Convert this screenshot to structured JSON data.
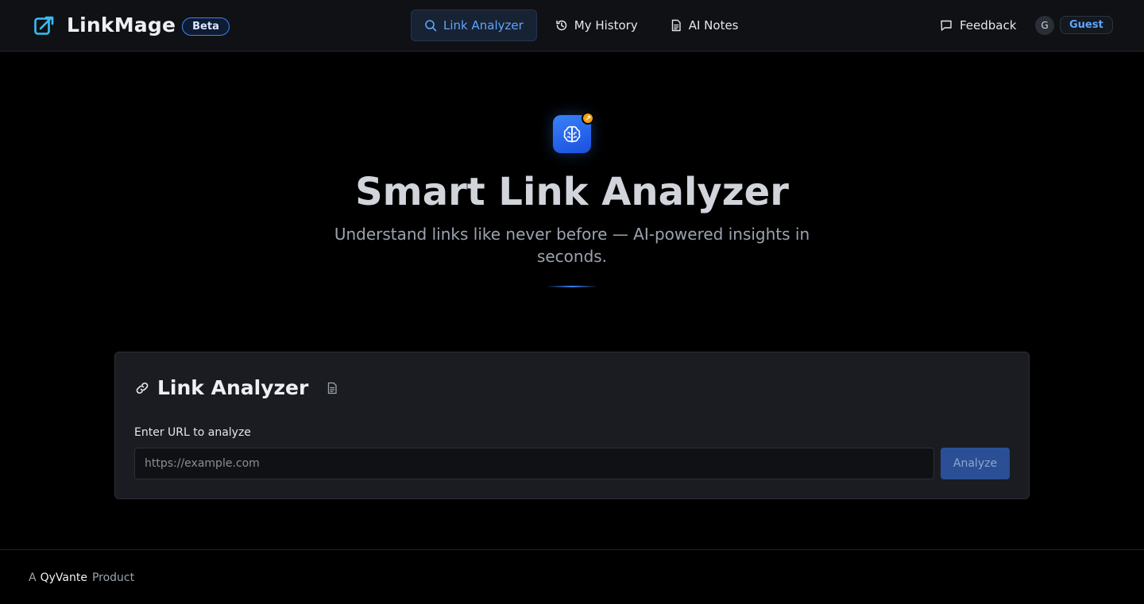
{
  "header": {
    "brand_name": "LinkMage",
    "beta_label": "Beta",
    "nav": [
      {
        "label": "Link Analyzer",
        "icon": "search-icon",
        "active": true
      },
      {
        "label": "My History",
        "icon": "history-icon",
        "active": false
      },
      {
        "label": "AI Notes",
        "icon": "document-icon",
        "active": false
      }
    ],
    "feedback_label": "Feedback",
    "avatar_initial": "G",
    "user_label": "Guest"
  },
  "hero": {
    "icon": "brain-icon",
    "badge_icon": "link-icon",
    "title": "Smart Link Analyzer",
    "subtitle": "Understand links like never before — AI-powered insights in seconds."
  },
  "analyzer": {
    "title": "Link Analyzer",
    "title_icon": "link-icon",
    "side_icon": "document-icon",
    "field_label": "Enter URL to analyze",
    "url_value": "",
    "url_placeholder": "https://example.com",
    "analyze_label": "Analyze"
  },
  "footer": {
    "prefix": "A",
    "company": "QyVante",
    "suffix": "Product"
  },
  "colors": {
    "accent": "#3b82f6",
    "accent_text": "#60a5fa",
    "badge": "#f59e0b",
    "background": "#000000",
    "card": "#1a1c21"
  }
}
